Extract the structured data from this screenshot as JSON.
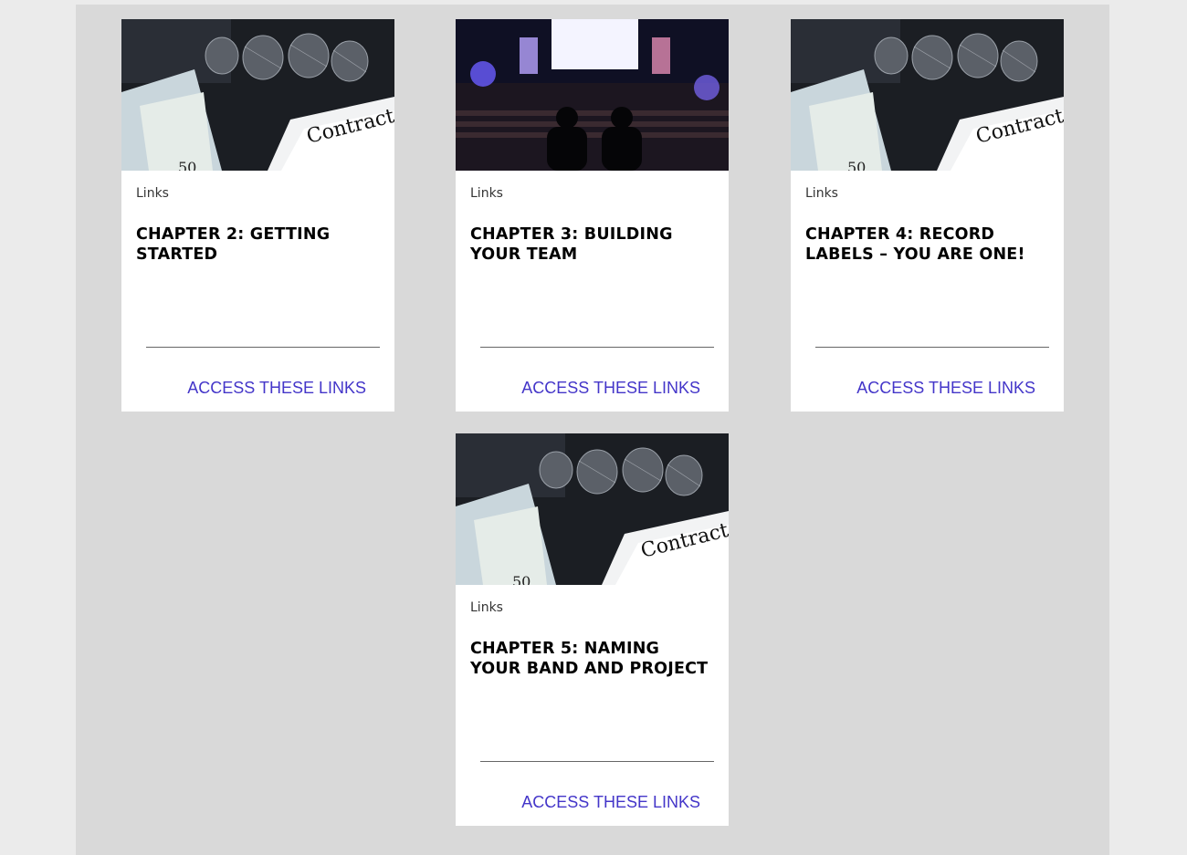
{
  "cards": [
    {
      "image": "microphones-and-contract-photo",
      "category": "Links",
      "title": "CHAPTER 2: GETTING STARTED",
      "cta": "ACCESS THESE LINKS",
      "contract_text": "Contract"
    },
    {
      "image": "concert-stage-silhouettes-photo",
      "category": "Links",
      "title": "CHAPTER 3: BUILDING YOUR TEAM",
      "cta": "ACCESS THESE LINKS"
    },
    {
      "image": "microphones-and-contract-photo",
      "category": "Links",
      "title": "CHAPTER 4: RECORD LABELS – YOU ARE ONE!",
      "cta": "ACCESS THESE LINKS",
      "contract_text": "Contract"
    },
    {
      "image": "microphones-and-contract-photo",
      "category": "Links",
      "title": "CHAPTER 5: NAMING YOUR BAND AND PROJECT",
      "cta": "ACCESS THESE LINKS",
      "contract_text": "Contract"
    }
  ],
  "colors": {
    "link": "#4436c9",
    "page_bg": "#ebebeb",
    "panel_bg": "#d9d9d9",
    "card_bg": "#ffffff"
  }
}
